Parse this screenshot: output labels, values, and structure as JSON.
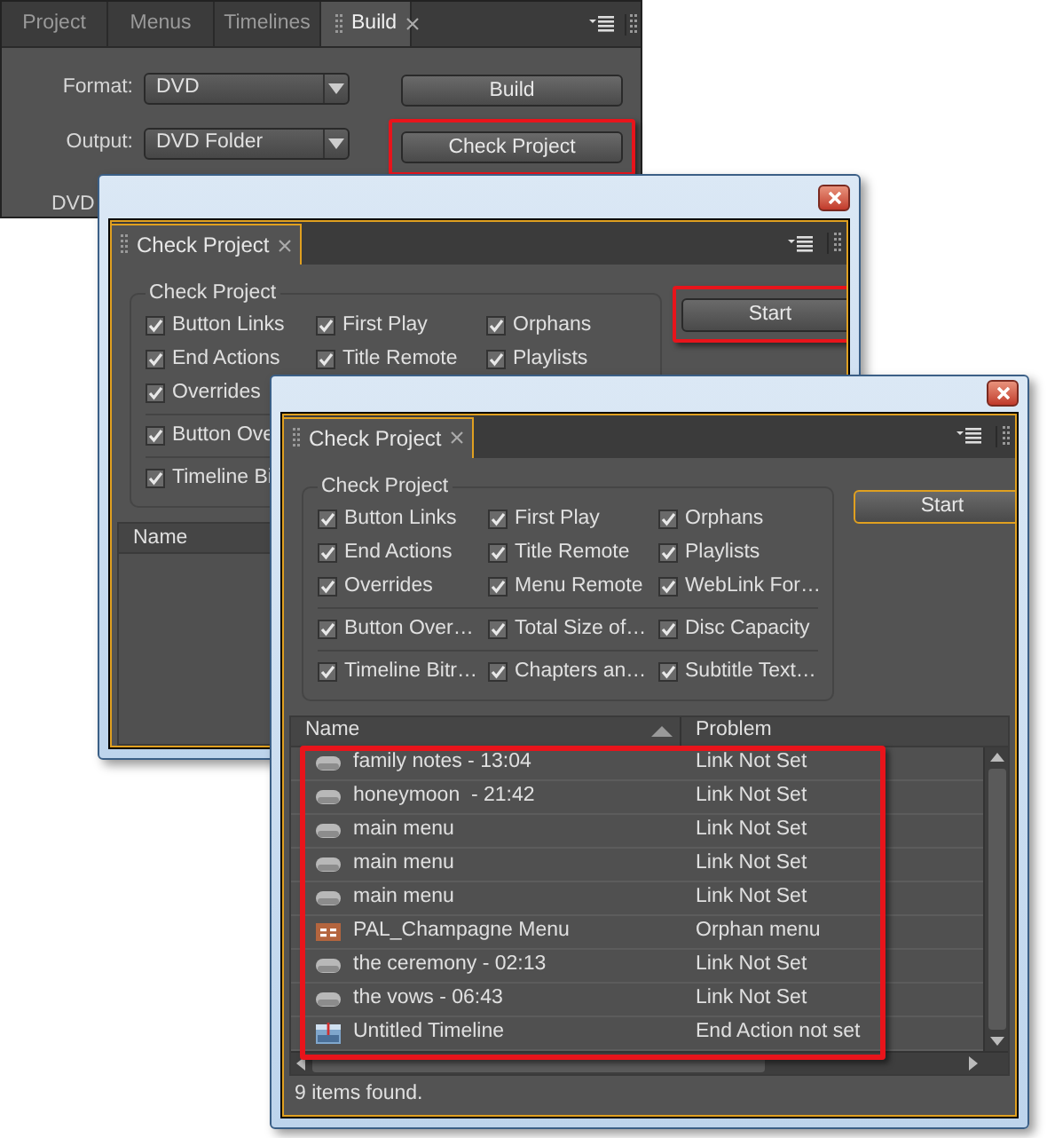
{
  "build_panel": {
    "tabs": [
      {
        "label": "Project",
        "selected": false
      },
      {
        "label": "Menus",
        "selected": false
      },
      {
        "label": "Timelines",
        "selected": false
      },
      {
        "label": "Build",
        "selected": true
      }
    ],
    "format": {
      "label": "Format:",
      "value": "DVD"
    },
    "output": {
      "label": "Output:",
      "value": "DVD Folder"
    },
    "buttons": [
      {
        "label": "Build",
        "highlighted": false
      },
      {
        "label": "Check Project",
        "highlighted": true
      }
    ],
    "cut_label": "DVD"
  },
  "dialogs": [
    {
      "tab": "Check Project",
      "group_title": "Check Project",
      "check_rows": [
        {
          "divider": false,
          "items": [
            {
              "label": "Button Links",
              "checked": true
            },
            {
              "label": "First Play",
              "checked": true
            },
            {
              "label": "Orphans",
              "checked": true
            }
          ]
        },
        {
          "divider": false,
          "items": [
            {
              "label": "End Actions",
              "checked": true
            },
            {
              "label": "Title Remote",
              "checked": true
            },
            {
              "label": "Playlists",
              "checked": true
            }
          ]
        },
        {
          "divider": false,
          "items": [
            {
              "label": "Overrides",
              "checked": true
            }
          ]
        },
        {
          "divider": true,
          "items": [
            {
              "label": "Button Ove",
              "checked": true
            }
          ]
        },
        {
          "divider": true,
          "items": [
            {
              "label": "Timeline Bi",
              "checked": true
            }
          ]
        }
      ],
      "start": {
        "label": "Start",
        "highlighted": true,
        "focused": false
      },
      "columns": [
        "Name"
      ]
    },
    {
      "tab": "Check Project",
      "group_title": "Check Project",
      "check_rows": [
        {
          "divider": false,
          "items": [
            {
              "label": "Button Links",
              "checked": true
            },
            {
              "label": "First Play",
              "checked": true
            },
            {
              "label": "Orphans",
              "checked": true
            }
          ]
        },
        {
          "divider": false,
          "items": [
            {
              "label": "End Actions",
              "checked": true
            },
            {
              "label": "Title Remote",
              "checked": true
            },
            {
              "label": "Playlists",
              "checked": true
            }
          ]
        },
        {
          "divider": false,
          "items": [
            {
              "label": "Overrides",
              "checked": true
            },
            {
              "label": "Menu Remote",
              "checked": true
            },
            {
              "label": "WebLink For…",
              "checked": true
            }
          ]
        },
        {
          "divider": true,
          "items": [
            {
              "label": "Button Over…",
              "checked": true
            },
            {
              "label": "Total Size of…",
              "checked": true
            },
            {
              "label": "Disc Capacity",
              "checked": true
            }
          ]
        },
        {
          "divider": true,
          "items": [
            {
              "label": "Timeline Bitr…",
              "checked": true
            },
            {
              "label": "Chapters an…",
              "checked": true
            },
            {
              "label": "Subtitle Text…",
              "checked": true
            }
          ]
        }
      ],
      "start": {
        "label": "Start",
        "highlighted": false,
        "focused": true
      },
      "columns": [
        "Name",
        "Problem"
      ],
      "list_highlighted": true,
      "rows": [
        {
          "kind": "button",
          "name": "family notes - 13:04",
          "problem": "Link Not Set"
        },
        {
          "kind": "button",
          "name": "honeymoon  - 21:42",
          "problem": "Link Not Set"
        },
        {
          "kind": "button",
          "name": "main menu",
          "problem": "Link Not Set"
        },
        {
          "kind": "button",
          "name": "main menu",
          "problem": "Link Not Set"
        },
        {
          "kind": "button",
          "name": "main menu",
          "problem": "Link Not Set"
        },
        {
          "kind": "menu",
          "name": "PAL_Champagne Menu",
          "problem": "Orphan menu"
        },
        {
          "kind": "button",
          "name": "the ceremony - 02:13",
          "problem": "Link Not Set"
        },
        {
          "kind": "button",
          "name": "the vows - 06:43",
          "problem": "Link Not Set"
        },
        {
          "kind": "timeline",
          "name": "Untitled Timeline",
          "problem": "End Action not set"
        }
      ],
      "status": "9 items found."
    }
  ]
}
